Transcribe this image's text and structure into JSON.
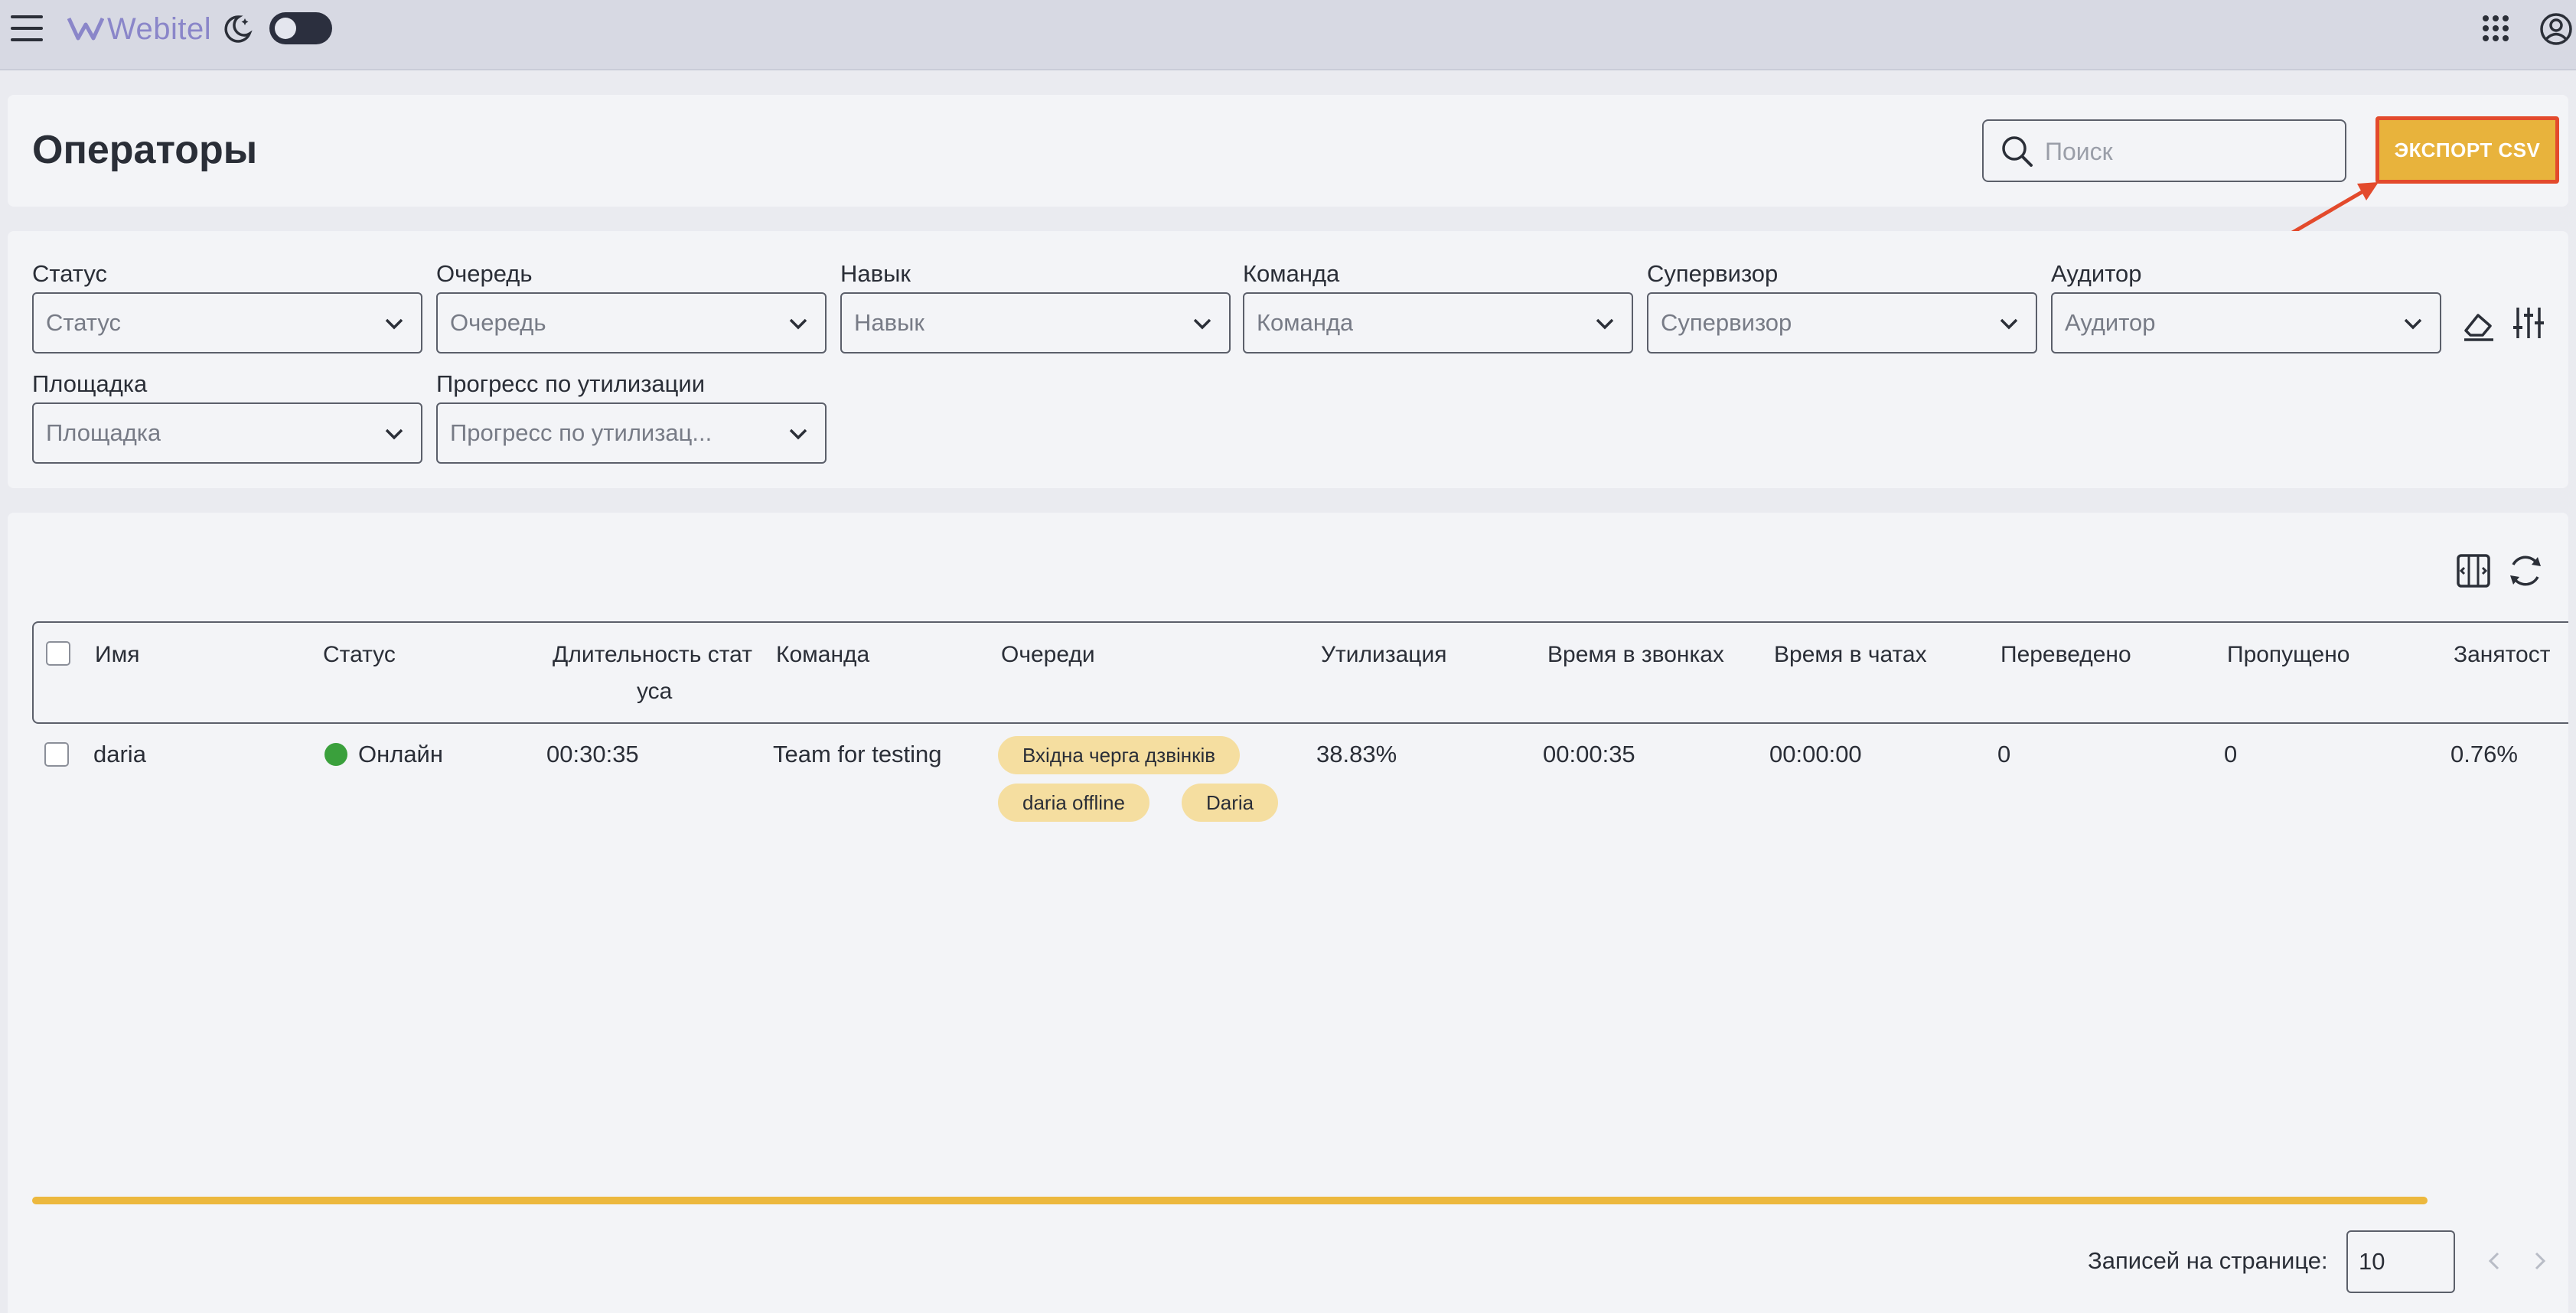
{
  "app": {
    "brand": "Webitel",
    "theme_toggle": "off"
  },
  "page": {
    "title": "Операторы"
  },
  "search": {
    "placeholder": "Поиск",
    "value": ""
  },
  "export_button": {
    "label": "ЭКСПОРТ CSV"
  },
  "filters": [
    {
      "label": "Статус",
      "placeholder": "Статус"
    },
    {
      "label": "Очередь",
      "placeholder": "Очередь"
    },
    {
      "label": "Навык",
      "placeholder": "Навык"
    },
    {
      "label": "Команда",
      "placeholder": "Команда"
    },
    {
      "label": "Супервизор",
      "placeholder": "Супервизор"
    },
    {
      "label": "Аудитор",
      "placeholder": "Аудитор"
    },
    {
      "label": "Площадка",
      "placeholder": "Площадка"
    },
    {
      "label": "Прогресс по утилизации",
      "placeholder": "Прогресс по утилизац..."
    }
  ],
  "table": {
    "columns": [
      "Имя",
      "Статус",
      "Длительность стат",
      "уса",
      "Команда",
      "Очереди",
      "Утилизация",
      "Время в звонках",
      "Время в чатах",
      "Переведено",
      "Пропущено",
      "Занятост"
    ],
    "rows": [
      {
        "name": "daria",
        "status": "Онлайн",
        "status_color": "#3aa03c",
        "status_duration": "00:30:35",
        "team": "Team for testing",
        "queues": [
          "Вхідна черга дзвінків",
          "daria offline",
          "Daria"
        ],
        "utilization": "38.83%",
        "call_time": "00:00:35",
        "chat_time": "00:00:00",
        "transferred": "0",
        "missed": "0",
        "occupancy": "0.76%"
      }
    ]
  },
  "pagination": {
    "label": "Записей на странице:",
    "per_page": "10"
  },
  "colors": {
    "accent": "#e8b33c",
    "annotation": "#e34a2c"
  }
}
